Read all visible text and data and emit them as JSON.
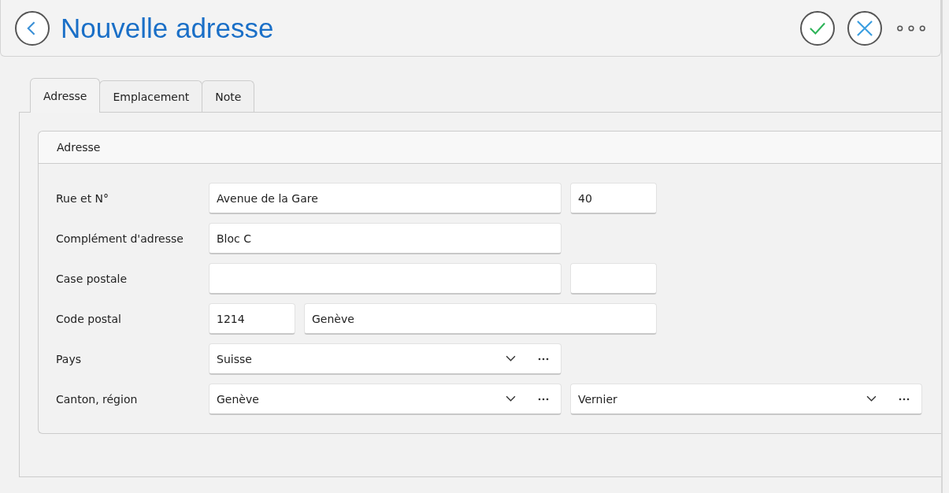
{
  "header": {
    "title": "Nouvelle adresse"
  },
  "tabs": [
    {
      "label": "Adresse",
      "selected": true
    },
    {
      "label": "Emplacement",
      "selected": false
    },
    {
      "label": "Note",
      "selected": false
    }
  ],
  "section": {
    "title": "Adresse",
    "rows": [
      {
        "label": "Rue et N°",
        "fields": [
          {
            "kind": "text",
            "value": "Avenue de la Gare"
          },
          {
            "kind": "text",
            "value": "40"
          }
        ]
      },
      {
        "label": "Complément d'adresse",
        "fields": [
          {
            "kind": "text",
            "value": "Bloc C"
          }
        ]
      },
      {
        "label": "Case postale",
        "fields": [
          {
            "kind": "text"
          },
          {
            "kind": "text"
          }
        ]
      },
      {
        "label": "Code postal",
        "fields": [
          {
            "kind": "text",
            "value": "1214"
          },
          {
            "kind": "text",
            "value": "Genève"
          }
        ]
      },
      {
        "label": "Pays",
        "fields": [
          {
            "kind": "combo",
            "value": "Suisse"
          }
        ]
      },
      {
        "label": "Canton, région",
        "fields": [
          {
            "kind": "combo",
            "value": "Genève"
          },
          {
            "kind": "combo",
            "value": "Vernier"
          }
        ]
      }
    ]
  }
}
